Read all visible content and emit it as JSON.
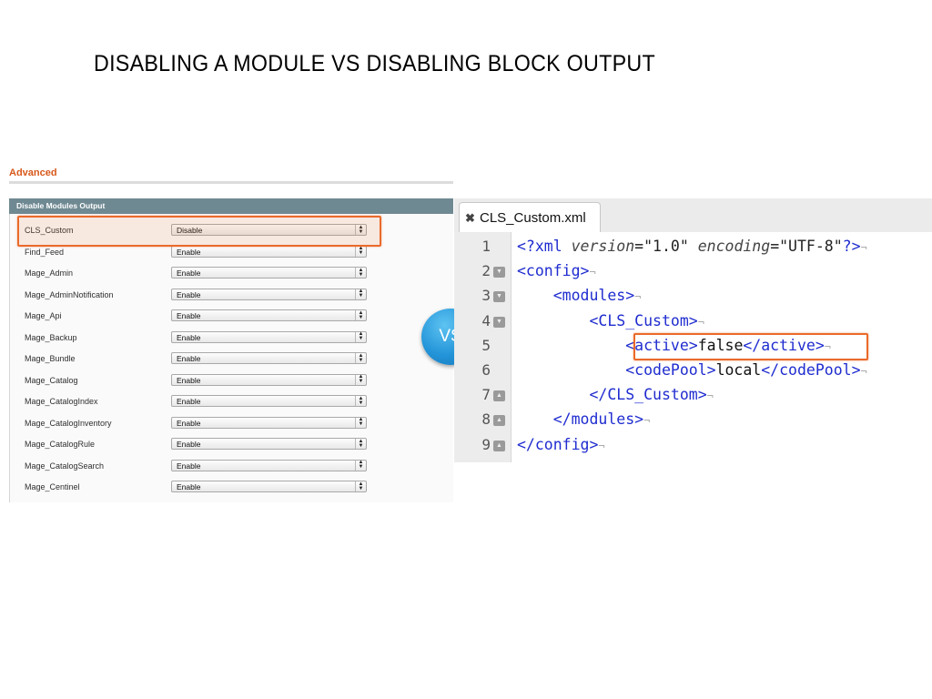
{
  "slide": {
    "title": "DISABLING A MODULE VS DISABLING BLOCK OUTPUT",
    "vs_label": "VS"
  },
  "admin": {
    "section_heading": "Advanced",
    "fieldset_title": "Disable Modules Output",
    "rows": [
      {
        "name": "CLS_Custom",
        "value": "Disable"
      },
      {
        "name": "Find_Feed",
        "value": "Enable"
      },
      {
        "name": "Mage_Admin",
        "value": "Enable"
      },
      {
        "name": "Mage_AdminNotification",
        "value": "Enable"
      },
      {
        "name": "Mage_Api",
        "value": "Enable"
      },
      {
        "name": "Mage_Backup",
        "value": "Enable"
      },
      {
        "name": "Mage_Bundle",
        "value": "Enable"
      },
      {
        "name": "Mage_Catalog",
        "value": "Enable"
      },
      {
        "name": "Mage_CatalogIndex",
        "value": "Enable"
      },
      {
        "name": "Mage_CatalogInventory",
        "value": "Enable"
      },
      {
        "name": "Mage_CatalogRule",
        "value": "Enable"
      },
      {
        "name": "Mage_CatalogSearch",
        "value": "Enable"
      },
      {
        "name": "Mage_Centinel",
        "value": "Enable"
      }
    ]
  },
  "editor": {
    "tab_label": "CLS_Custom.xml",
    "close_icon": "close-icon",
    "lines": [
      {
        "number": "1",
        "indent": "",
        "tag_open": "<?xml ",
        "attr1": "version",
        "eq1": "=",
        "val1": "\"1.0\"",
        "sp": " ",
        "attr2": "encoding",
        "eq2": "=",
        "val2": "\"UTF-8\"",
        "tag_close": "?>"
      },
      {
        "number": "2",
        "indent": "",
        "tag_open": "<config>"
      },
      {
        "number": "3",
        "indent": "    ",
        "tag_open": "<modules>"
      },
      {
        "number": "4",
        "indent": "        ",
        "tag_open": "<CLS_Custom>"
      },
      {
        "number": "5",
        "indent": "            ",
        "tag_open": "<active>",
        "text": "false",
        "tag_close": "</active>"
      },
      {
        "number": "6",
        "indent": "            ",
        "tag_open": "<codePool>",
        "text": "local",
        "tag_close": "</codePool>"
      },
      {
        "number": "7",
        "indent": "        ",
        "tag_open": "</CLS_Custom>"
      },
      {
        "number": "8",
        "indent": "    ",
        "tag_open": "</modules>"
      },
      {
        "number": "9",
        "indent": "",
        "tag_open": "</config>"
      }
    ],
    "pilcrow": "¬"
  },
  "colors": {
    "accent_orange": "#ea6a2b",
    "header_gray": "#6f8992",
    "tag_blue": "#1f2ccf",
    "vs_blue": "#2495d9"
  }
}
